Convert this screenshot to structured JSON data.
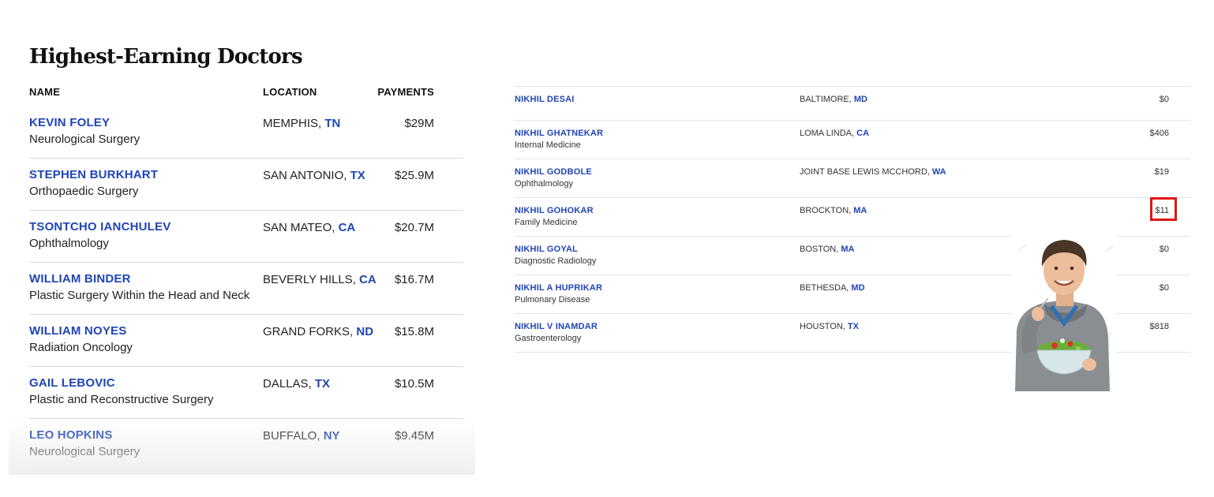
{
  "left": {
    "title": "Highest-Earning Doctors",
    "headers": {
      "name": "NAME",
      "location": "LOCATION",
      "payments": "PAYMENTS"
    },
    "rows": [
      {
        "name": "KEVIN FOLEY",
        "specialty": "Neurological Surgery",
        "city": "MEMPHIS, ",
        "state": "TN",
        "payment": "$29M"
      },
      {
        "name": "STEPHEN BURKHART",
        "specialty": "Orthopaedic Surgery",
        "city": "SAN ANTONIO, ",
        "state": "TX",
        "payment": "$25.9M"
      },
      {
        "name": "TSONTCHO IANCHULEV",
        "specialty": "Ophthalmology",
        "city": "SAN MATEO, ",
        "state": "CA",
        "payment": "$20.7M"
      },
      {
        "name": "WILLIAM BINDER",
        "specialty": "Plastic Surgery Within the Head and Neck",
        "city": "BEVERLY HILLS, ",
        "state": "CA",
        "payment": "$16.7M"
      },
      {
        "name": "WILLIAM NOYES",
        "specialty": "Radiation Oncology",
        "city": "GRAND FORKS, ",
        "state": "ND",
        "payment": "$15.8M"
      },
      {
        "name": "GAIL LEBOVIC",
        "specialty": "Plastic and Reconstructive Surgery",
        "city": "DALLAS, ",
        "state": "TX",
        "payment": "$10.5M"
      },
      {
        "name": "LEO HOPKINS",
        "specialty": "Neurological Surgery",
        "city": "BUFFALO, ",
        "state": "NY",
        "payment": "$9.45M"
      }
    ]
  },
  "right": {
    "rows": [
      {
        "name": "NIKHIL DESAI",
        "specialty": "",
        "city": "BALTIMORE, ",
        "state": "MD",
        "payment": "$0"
      },
      {
        "name": "NIKHIL GHATNEKAR",
        "specialty": "Internal Medicine",
        "city": "LOMA LINDA, ",
        "state": "CA",
        "payment": "$406"
      },
      {
        "name": "NIKHIL GODBOLE",
        "specialty": "Ophthalmology",
        "city": "JOINT BASE LEWIS MCCHORD, ",
        "state": "WA",
        "payment": "$19"
      },
      {
        "name": "NIKHIL GOHOKAR",
        "specialty": "Family Medicine",
        "city": "BROCKTON, ",
        "state": "MA",
        "payment": "$11"
      },
      {
        "name": "NIKHIL GOYAL",
        "specialty": "Diagnostic Radiology",
        "city": "BOSTON, ",
        "state": "MA",
        "payment": "$0"
      },
      {
        "name": "NIKHIL A HUPRIKAR",
        "specialty": "Pulmonary Disease",
        "city": "BETHESDA, ",
        "state": "MD",
        "payment": "$0"
      },
      {
        "name": "NIKHIL V INAMDAR",
        "specialty": "Gastroenterology",
        "city": "HOUSTON, ",
        "state": "TX",
        "payment": "$818"
      }
    ],
    "highlighted_row": 3
  },
  "colors": {
    "link_blue": "#1f45b5",
    "highlight_red": "#e01616",
    "divider": "#d9d9d9"
  },
  "photo": {
    "icon": "man-eating-salad-photo"
  }
}
